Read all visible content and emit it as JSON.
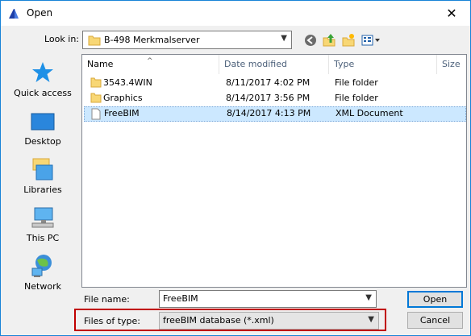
{
  "window": {
    "title": "Open",
    "close_glyph": "✕"
  },
  "lookin": {
    "label": "Look in:",
    "value": "B-498 Merkmalserver"
  },
  "toolbar": {
    "back_icon": "back-icon",
    "up_icon": "up-folder-icon",
    "new_folder_icon": "new-folder-icon",
    "view_icon": "view-menu-icon"
  },
  "places": [
    {
      "label": "Quick access",
      "icon": "star-icon"
    },
    {
      "label": "Desktop",
      "icon": "desktop-icon"
    },
    {
      "label": "Libraries",
      "icon": "libraries-icon"
    },
    {
      "label": "This PC",
      "icon": "computer-icon"
    },
    {
      "label": "Network",
      "icon": "network-icon"
    }
  ],
  "columns": [
    "Name",
    "Date modified",
    "Type",
    "Size"
  ],
  "files": [
    {
      "name": "3543.4WIN",
      "date": "8/11/2017 4:02 PM",
      "type": "File folder",
      "kind": "folder"
    },
    {
      "name": "Graphics",
      "date": "8/14/2017 3:56 PM",
      "type": "File folder",
      "kind": "folder"
    },
    {
      "name": "FreeBIM",
      "date": "8/14/2017 4:13 PM",
      "type": "XML Document",
      "kind": "file"
    }
  ],
  "filename": {
    "label": "File name:",
    "value": "FreeBIM"
  },
  "filetype": {
    "label": "Files of type:",
    "value": "freeBIM database (*.xml)"
  },
  "buttons": {
    "open": "Open",
    "cancel": "Cancel"
  },
  "colors": {
    "accent": "#0078d7",
    "selection": "#cce8ff",
    "highlight_box": "#c00000",
    "folder": "#f8d775"
  }
}
